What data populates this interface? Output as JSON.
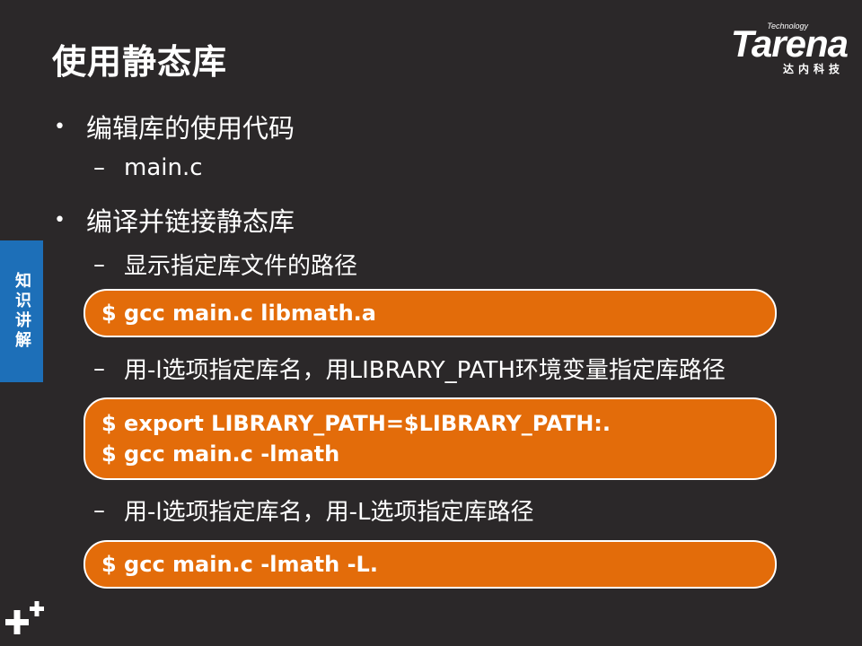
{
  "slide": {
    "title": "使用静态库",
    "side_tab": "知识讲解"
  },
  "logo": {
    "tech": "Technology",
    "word": "Tarena",
    "cn": "达内科技"
  },
  "bullets": [
    {
      "dot": "•",
      "text": "编辑库的使用代码"
    },
    {
      "dot": "•",
      "text": "编译并链接静态库"
    }
  ],
  "subs": [
    {
      "dash": "–",
      "text": "main.c"
    },
    {
      "dash": "–",
      "text": "显示指定库文件的路径"
    },
    {
      "dash": "–",
      "text": "用-l选项指定库名，用LIBRARY_PATH环境变量指定库路径"
    },
    {
      "dash": "–",
      "text": "用-l选项指定库名，用-L选项指定库路径"
    }
  ],
  "code_blocks": [
    {
      "lines": [
        "$ gcc main.c libmath.a"
      ]
    },
    {
      "lines": [
        "$ export LIBRARY_PATH=$LIBRARY_PATH:.",
        "$ gcc main.c -lmath"
      ]
    },
    {
      "lines": [
        "$ gcc main.c -lmath -L."
      ]
    }
  ],
  "colors": {
    "background": "#2b2829",
    "code_fill": "#e36c0a",
    "side_tab": "#1d6fb8"
  },
  "icons": {
    "corner": "plus-icon"
  }
}
